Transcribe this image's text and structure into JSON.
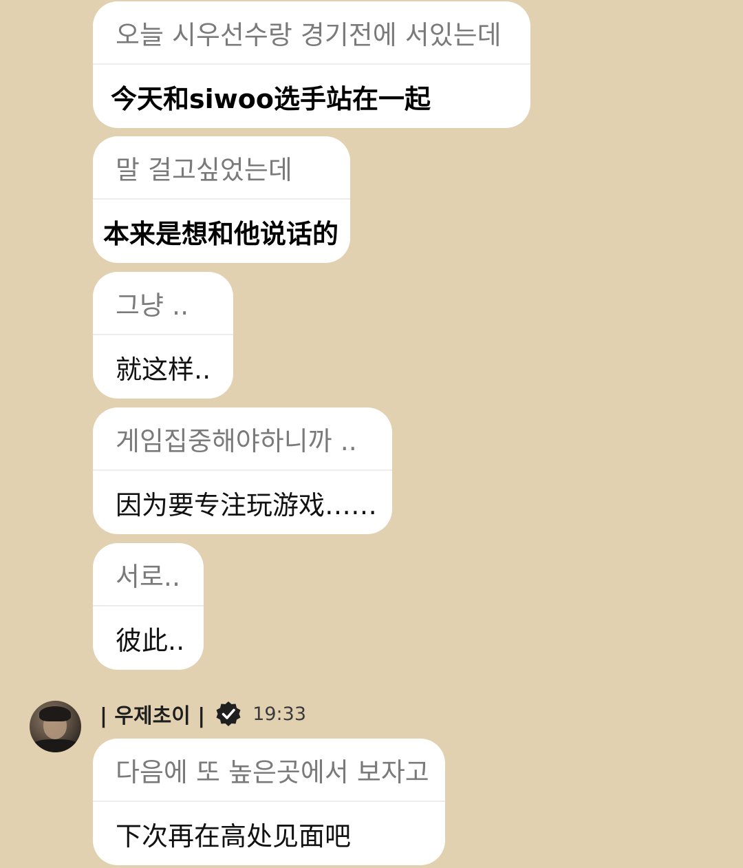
{
  "messages_prev": [
    {
      "ko": "오늘 시우선수랑 경기전에 서있는데",
      "zh": "今天和siwoo选手站在一起"
    },
    {
      "ko": "말 걸고싶었는데",
      "zh": "本来是想和他说话的"
    },
    {
      "ko": "그냥 ..",
      "zh": "就这样.."
    },
    {
      "ko": "게임집중해야하니까 ..",
      "zh": "因为要专注玩游戏……"
    },
    {
      "ko": "서로..",
      "zh": "彼此.."
    }
  ],
  "sender": {
    "name": "| 우제초이 |",
    "time": "19:33",
    "badge_icon": "verified-check-icon"
  },
  "message_last": {
    "ko": "다음에 또 높은곳에서 보자고",
    "zh": "下次再在高处见面吧"
  },
  "colors": {
    "background": "#e1d1b1",
    "bubble": "#ffffff",
    "korean_text": "#7a7a7a",
    "chinese_text": "#111111"
  }
}
